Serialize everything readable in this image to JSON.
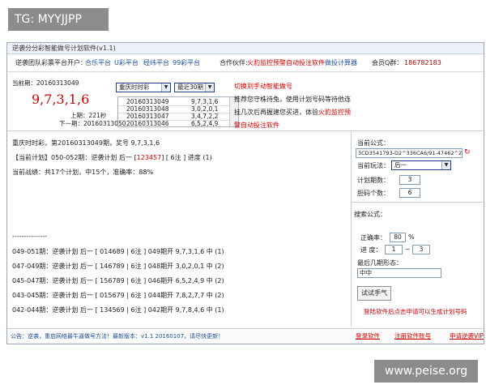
{
  "overlay": {
    "tg_label": "TG: MYYJJPP",
    "watermark": "www.peise.org"
  },
  "window": {
    "title": "逆袭分分彩智能做号计划软件(v1.1)"
  },
  "linkbar": {
    "platform_label": "逆袭团队彩票平台开户：",
    "links": [
      "合乐平台",
      "U彩平台",
      "经纬平台",
      "99彩平台"
    ],
    "partner_label": "合作伙伴:",
    "partner_link": "火豹监控预警自动投注软件",
    "partner_link2": "做投计算器",
    "member_label": "会员Q群：",
    "member_qq": "186782183"
  },
  "current": {
    "period_label": "当前期：20160313049",
    "numbers": "9,7,3,1,6",
    "prev_label": "上期：",
    "prev_value": "221秒",
    "next_label": "下一期：20160313050"
  },
  "selectors": {
    "lottery": "重庆时时彩",
    "range": "最近30期"
  },
  "history": [
    {
      "period": "20160313049",
      "nums": "9,7,3,1,6"
    },
    {
      "period": "20160313048",
      "nums": "3,0,2,0,1"
    },
    {
      "period": "20160313047",
      "nums": "3,4,7,2,2"
    },
    {
      "period": "20160313046",
      "nums": "6,5,2,4,9"
    }
  ],
  "notice": {
    "line1": "切换到手动智能做号",
    "line2_a": "推荐您守株待兔，使用计划号码等待他连",
    "line3_a": "挂几次后再握建您买进，体验",
    "line3_b": "火豹监控预",
    "line4": "警自动投注软件"
  },
  "result": {
    "header": "重庆时时彩，第20160313049期，奖号 9,7,3,1,6",
    "plan_prefix": "【当前计划】050-052期：逆袭计划 后一 [",
    "plan_nums": "123457",
    "plan_suffix": "] [ 6注 ] 进度 (1)",
    "stats": "当前战绩：共17个计划，中15个，准确率：88%",
    "divider": "---------------",
    "rows": [
      "049-051期：逆袭计划 后一 [ 014689 | 6注 ] 049期开 9,7,3,1,6 中 (1)",
      "047-049期：逆袭计划 后一 [ 146789 | 6注 ] 048期开 3,0,2,0,1 中 (2)",
      "045-047期：逆袭计划 后一 [ 156789 | 6注 ] 046期开 6,5,2,4,9 中 (2)",
      "043-045期：逆袭计划 后一 [ 015679 | 6注 ] 044期开 7,8,2,7,7 中 (2)",
      "042-044期：逆袭计划 后一 [ 134569 | 6注 ] 042期开 9,7,8,4,6 中 (1)",
      "040-042期：逆袭计划 后一 [ 123579 | 6注 ] 041期开 1,3,1,6,1 中 (2)",
      "037-039期：逆袭计划 后一 [ 123489 | 6注 ] 039期开 1,9,4,2,9 中 (3)"
    ]
  },
  "panel": {
    "formula_label": "当前公式：",
    "formula_value": "3CD3541793-D2^336CA6/91-47462^2",
    "play_label": "当前玩法：",
    "play_value": "后一",
    "periods_label": "计划期数：",
    "periods_value": "3",
    "count_label": "胆码个数：",
    "count_value": "6",
    "search_label": "搜索公式：",
    "accuracy_label": "正确率：",
    "accuracy_value": "80",
    "accuracy_unit": "%",
    "progress_label": "进 度：",
    "progress_from": "1",
    "progress_sep": "~",
    "progress_to": "3",
    "recent_label": "最后几期形态：",
    "recent_value": "中中",
    "try_button": "试试手气",
    "register_tip": "登陆软件后点击申请可以生成计划号码"
  },
  "status": {
    "announce": "公告：逆袭，重启网络最牛逼做号方法！最新版本：v1.1 20160107，请尽快更新！",
    "login": "登录软件",
    "register": "注册软件账号",
    "apply": "申请逆袭VIP"
  },
  "colors": {
    "link_blue": "#1d4f9a",
    "accent_red": "#d10000"
  }
}
